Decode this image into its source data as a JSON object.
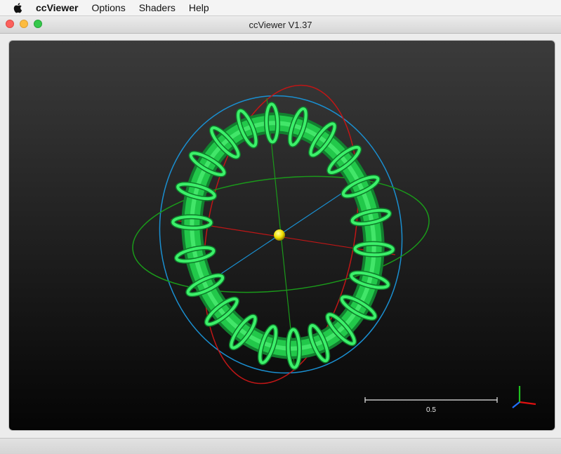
{
  "menubar": {
    "apple_icon": "apple-logo-icon",
    "app_name": "ccViewer",
    "items": [
      "Options",
      "Shaders",
      "Help"
    ]
  },
  "window": {
    "title": "ccViewer V1.37",
    "buttons": {
      "close": "#fc605c",
      "minimize": "#fdbc40",
      "maximize": "#34c84a"
    }
  },
  "viewport": {
    "background": [
      "#3b3b3b",
      "#050505"
    ],
    "object_color": "#2ee65a",
    "center_sphere_color": "#f0e000",
    "trackball_colors": {
      "x": "#c01616",
      "y": "#1a9a1a",
      "z": "#1a8fd0"
    },
    "scale_bar_label": "0.5",
    "axis_colors": {
      "x": "#e01010",
      "y": "#20c020",
      "z": "#2070ff"
    }
  }
}
